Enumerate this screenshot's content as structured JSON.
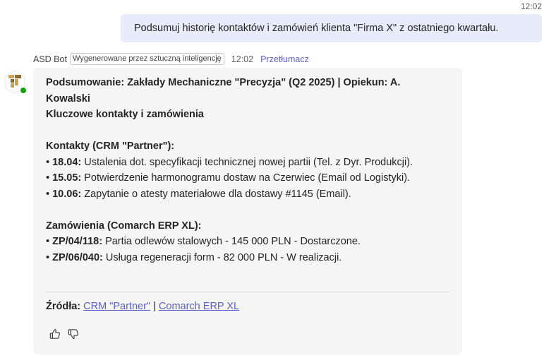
{
  "user_message": {
    "time": "12:02",
    "text": "Podsumuj historię kontaktów i zamówień klienta \"Firma X\" z ostatniego kwartału."
  },
  "bot": {
    "name": "ASD Bot",
    "ai_badge": "Wygenerowane przez sztuczną inteligencję",
    "time": "12:02",
    "translate_label": "Przetłumacz",
    "status_color": "#13a10e",
    "avatar_icon": "bot-logo-icon"
  },
  "summary": {
    "title_line1": "Podsumowanie: Zakłady Mechaniczne \"Precyzja\" (Q2 2025) | Opiekun: A.",
    "title_line2": "Kowalski",
    "subtitle": "Kluczowe kontakty i zamówienia",
    "contacts_heading": "Kontakty (CRM \"Partner\"):",
    "contacts": [
      {
        "date": "18.04:",
        "text": " Ustalenia dot. specyfikacji technicznej nowej partii (Tel. z Dyr. Produkcji)."
      },
      {
        "date": "15.05:",
        "text": " Potwierdzenie harmonogramu dostaw na Czerwiec (Email od Logistyki)."
      },
      {
        "date": "10.06:",
        "text": " Zapytanie o atesty materiałowe dla dostawy #1145 (Email)."
      }
    ],
    "orders_heading": "Zamówienia (Comarch ERP XL):",
    "orders": [
      {
        "id": "ZP/04/118:",
        "text": " Partia odlewów stalowych - 145 000 PLN - Dostarczone."
      },
      {
        "id": "ZP/06/040:",
        "text": " Usługa regeneracji form - 82 000 PLN - W realizacji."
      }
    ]
  },
  "sources": {
    "label": "Źródła:",
    "link1": "CRM \"Partner\"",
    "separator": "|",
    "link2": "Comarch ERP XL"
  },
  "reactions": {
    "like_icon": "thumbs-up-icon",
    "dislike_icon": "thumbs-down-icon"
  },
  "colors": {
    "user_bubble": "#e8ebfa",
    "bot_bubble": "#f5f5f5",
    "link": "#5b5fc7"
  }
}
